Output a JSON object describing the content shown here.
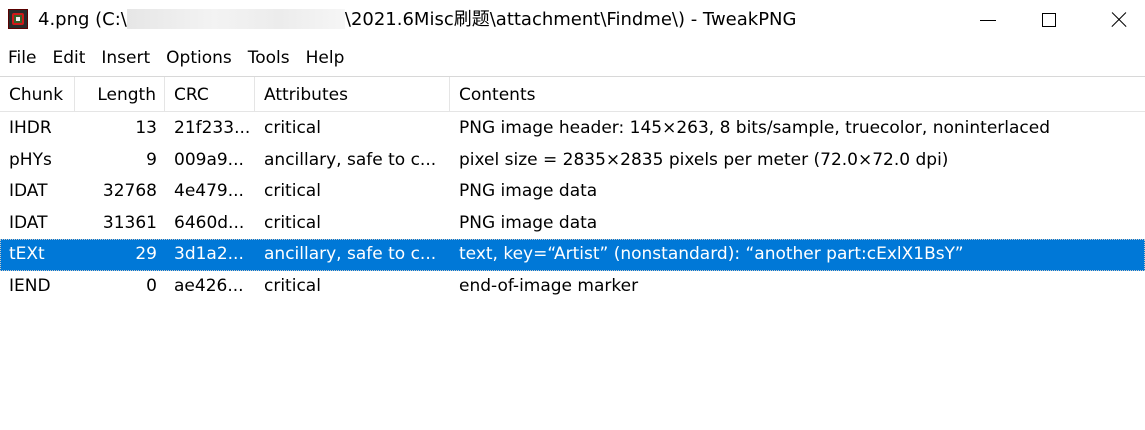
{
  "window": {
    "title_prefix": "4.png (C:\\",
    "title_suffix": "\\2021.6Misc刷题\\attachment\\Findme\\) - TweakPNG",
    "icon": "tweakpng-app-icon",
    "controls": [
      "minimize-icon",
      "maximize-icon",
      "close-icon"
    ]
  },
  "menu": {
    "file": "File",
    "edit": "Edit",
    "insert": "Insert",
    "options": "Options",
    "tools": "Tools",
    "help": "Help"
  },
  "table": {
    "columns": {
      "chunk": "Chunk",
      "length": "Length",
      "crc": "CRC",
      "attributes": "Attributes",
      "contents": "Contents"
    },
    "rows": [
      {
        "chunk": "IHDR",
        "length": "13",
        "crc": "21f233...",
        "attributes": "critical",
        "contents": "PNG image header: 145×263, 8 bits/sample, truecolor, noninterlaced"
      },
      {
        "chunk": "pHYs",
        "length": "9",
        "crc": "009a9...",
        "attributes": "ancillary, safe to c...",
        "contents": "pixel size = 2835×2835 pixels per meter (72.0×72.0 dpi)"
      },
      {
        "chunk": "IDAT",
        "length": "32768",
        "crc": "4e479...",
        "attributes": "critical",
        "contents": "PNG image data"
      },
      {
        "chunk": "IDAT",
        "length": "31361",
        "crc": "6460d...",
        "attributes": "critical",
        "contents": "PNG image data"
      },
      {
        "chunk": "tEXt",
        "length": "29",
        "crc": "3d1a2...",
        "attributes": "ancillary, safe to c...",
        "contents": "text, key=“Artist” (nonstandard): “another part:cExlX1BsY”",
        "selected": true
      },
      {
        "chunk": "IEND",
        "length": "0",
        "crc": "ae426...",
        "attributes": "critical",
        "contents": "end-of-image marker"
      }
    ]
  },
  "colors": {
    "selection": "#0078d7",
    "selection_text": "#ffffff"
  }
}
